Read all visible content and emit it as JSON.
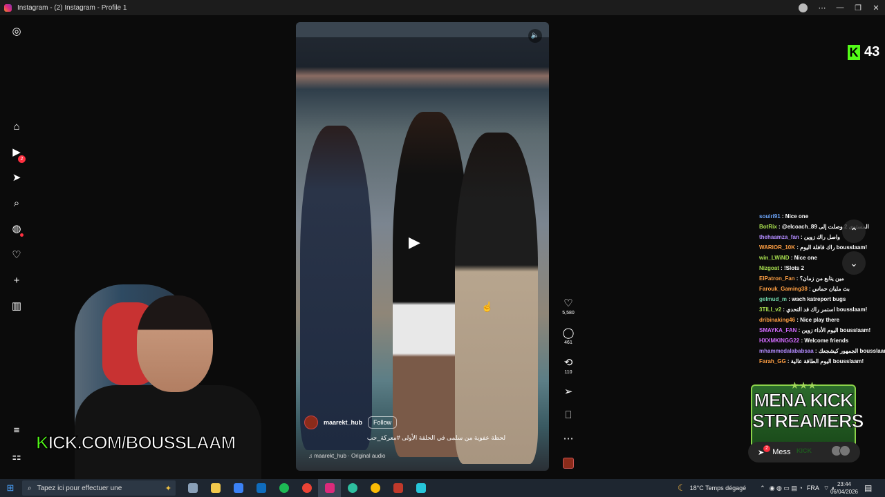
{
  "window": {
    "title": "Instagram - (2) Instagram - Profile 1",
    "controls": [
      "⋯",
      "—",
      "❐",
      "✕"
    ]
  },
  "sidebar": {
    "items": [
      {
        "name": "instagram-logo-icon",
        "glyph": "◎"
      },
      {
        "name": "home-icon",
        "glyph": "⌂"
      },
      {
        "name": "reels-icon",
        "glyph": "▶"
      },
      {
        "name": "messages-icon",
        "glyph": "➤"
      },
      {
        "name": "search-icon",
        "glyph": "⌕"
      },
      {
        "name": "explore-icon",
        "glyph": "◍"
      },
      {
        "name": "notifications-icon",
        "glyph": "♡"
      },
      {
        "name": "create-icon",
        "glyph": "+"
      },
      {
        "name": "dashboard-icon",
        "glyph": "▥"
      },
      {
        "name": "more-menu-icon",
        "glyph": "≡"
      },
      {
        "name": "also-from-meta-icon",
        "glyph": "⚏"
      }
    ],
    "messages_badge": "2"
  },
  "video": {
    "mute_icon": "🔈",
    "play_icon": "▶",
    "author_handle": "maarekt_hub",
    "follow_label": "Follow",
    "caption": "لحظة عفوية من سلمى في الحلقة الأولى #معركة_حب",
    "audio": "♫ maarekt_hub · Original audio"
  },
  "actions": {
    "likes": "5,580",
    "comments": "461",
    "reposts": "110"
  },
  "overlay": {
    "kick_logo": "K",
    "viewer_count": "43",
    "kick_url_prefix": "K",
    "kick_url_rest": "ICK.COM/BOUSSLAAM",
    "mena_stars": "★★★",
    "mena_line1": "MENA KICK",
    "mena_line2": "STREAMERS"
  },
  "chat": [
    {
      "user": "souiri91",
      "color": "#6fa8ff",
      "msg": "Nice one"
    },
    {
      "user": "BotRix",
      "color": "#a9e04f",
      "msg": "@elcoach_89 المستوى 2 وصلت إلى"
    },
    {
      "user": "thehaamza_fan",
      "color": "#b38cff",
      "msg": "واصل راك زوين"
    },
    {
      "user": "WARIOR_10K",
      "color": "#ff9f43",
      "msg": "راك قافلة اليوم bousslaam!"
    },
    {
      "user": "win_LWiND",
      "color": "#a9e04f",
      "msg": "Nice one"
    },
    {
      "user": "Nizgoat",
      "color": "#a9e04f",
      "msg": "!Slots 2"
    },
    {
      "user": "ElPatron_Fan",
      "color": "#ff9f43",
      "msg": "مين يتابع من زمان؟"
    },
    {
      "user": "Farouk_Gaming38",
      "color": "#ff9f43",
      "msg": "بث مليان حماس"
    },
    {
      "user": "gelmud_m",
      "color": "#6fd3a8",
      "msg": "wach katreport bugs"
    },
    {
      "user": "3TILI_v2",
      "color": "#a9e04f",
      "msg": "استمر راك قد التحدي bousslaam!"
    },
    {
      "user": "dribinaking46",
      "color": "#ff9f43",
      "msg": "Nice play there"
    },
    {
      "user": "SMAYKA_FAN",
      "color": "#d26bff",
      "msg": "اليوم الأداء زوين bousslaam!"
    },
    {
      "user": "HXXMKINGG22",
      "color": "#d26bff",
      "msg": "Welcome friends"
    },
    {
      "user": "mhammedalababsaa",
      "color": "#b38cff",
      "msg": "الجمهور كيشجعك bousslaam!"
    },
    {
      "user": "Farah_GG",
      "color": "#ff9f43",
      "msg": "اليوم الطاقة عالية bousslaam!"
    }
  ],
  "messages_pill": {
    "label": "Mess",
    "badge": "2",
    "kick_tag": "KICK"
  },
  "taskbar": {
    "search_placeholder": "Tapez ici pour effectuer une",
    "apps": [
      {
        "name": "task-view-icon",
        "color": "#8aa0b8"
      },
      {
        "name": "file-explorer-icon",
        "color": "#f2c94c"
      },
      {
        "name": "store-icon",
        "color": "#3b82f6"
      },
      {
        "name": "outlook-icon",
        "color": "#0f6cbd"
      },
      {
        "name": "spotify-icon",
        "color": "#1db954"
      },
      {
        "name": "chrome-icon",
        "color": "#ea4335"
      },
      {
        "name": "instagram-app-icon",
        "color": "#dd2a7b"
      },
      {
        "name": "edge-icon",
        "color": "#2ebf9f"
      },
      {
        "name": "chrome-profile-icon",
        "color": "#fbbc05"
      },
      {
        "name": "media-app-icon",
        "color": "#c0392b"
      },
      {
        "name": "tool-app-icon",
        "color": "#26c6da"
      }
    ],
    "weather": "18°C  Temps dégagé",
    "lang": "FRA",
    "time": "23:44",
    "date": "06/04/2026"
  }
}
